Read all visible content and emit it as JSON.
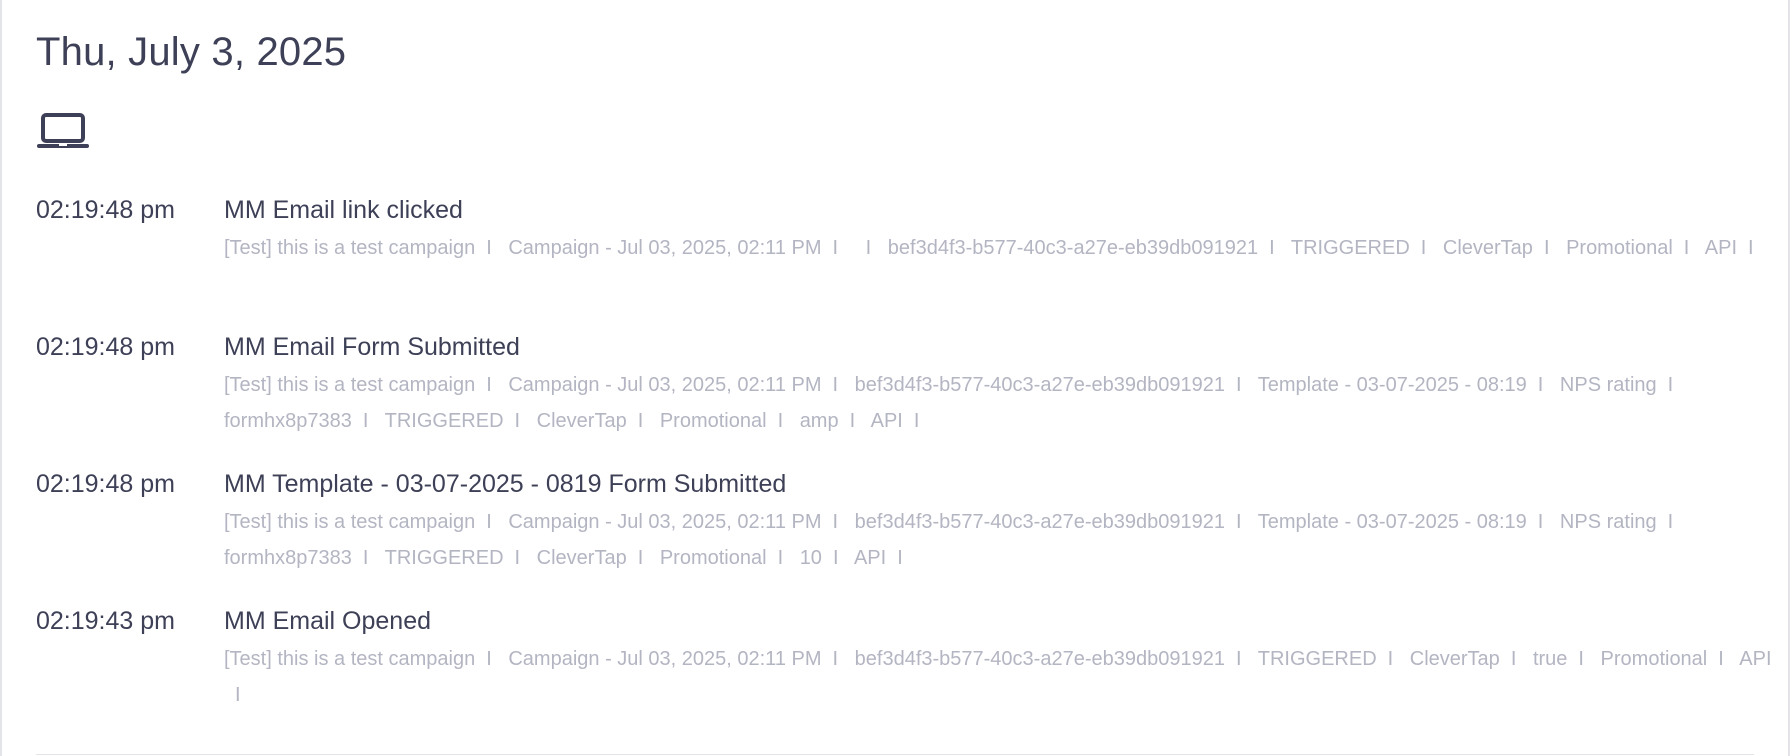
{
  "date_title": "Thu, July 3, 2025",
  "device_icon": "laptop-icon",
  "colors": {
    "text_primary": "#3d4056",
    "text_muted": "#b3b5c2",
    "border": "#e3e4e8"
  },
  "separator": "I",
  "events": [
    {
      "time": "02:19:48 pm",
      "name": "MM Email link clicked",
      "props": [
        "[Test] this is a test campaign",
        "Campaign - Jul 03, 2025, 02:11 PM",
        "",
        "bef3d4f3-b577-40c3-a27e-eb39db091921",
        "TRIGGERED",
        "CleverTap",
        "Promotional",
        "API"
      ]
    },
    {
      "time": "02:19:48 pm",
      "name": "MM Email Form Submitted",
      "props": [
        "[Test] this is a test campaign",
        "Campaign - Jul 03, 2025, 02:11 PM",
        "bef3d4f3-b577-40c3-a27e-eb39db091921",
        "Template - 03-07-2025 - 08:19",
        "NPS rating",
        "formhx8p7383",
        "TRIGGERED",
        "CleverTap",
        "Promotional",
        "amp",
        "API"
      ]
    },
    {
      "time": "02:19:48 pm",
      "name": "MM Template - 03-07-2025 - 0819 Form Submitted",
      "props": [
        "[Test] this is a test campaign",
        "Campaign - Jul 03, 2025, 02:11 PM",
        "bef3d4f3-b577-40c3-a27e-eb39db091921",
        "Template - 03-07-2025 - 08:19",
        "NPS rating",
        "formhx8p7383",
        "TRIGGERED",
        "CleverTap",
        "Promotional",
        "10",
        "API"
      ]
    },
    {
      "time": "02:19:43 pm",
      "name": "MM Email Opened",
      "props": [
        "[Test] this is a test campaign",
        "Campaign - Jul 03, 2025, 02:11 PM",
        "bef3d4f3-b577-40c3-a27e-eb39db091921",
        "TRIGGERED",
        "CleverTap",
        "true",
        "Promotional",
        "API"
      ]
    }
  ]
}
